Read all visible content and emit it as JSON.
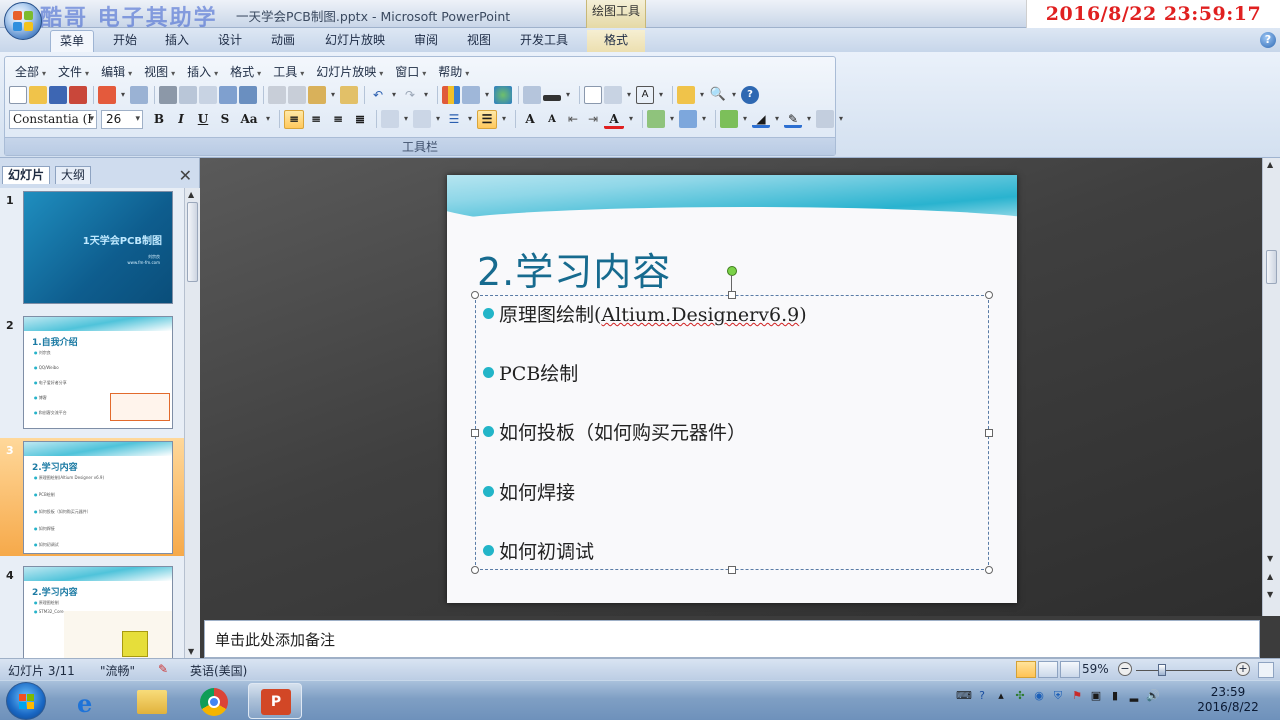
{
  "window": {
    "doc_title": "一天学会PCB制图.pptx",
    "app_name": "Microsoft PowerPoint",
    "context_tool": "绘图工具",
    "watermark": "酷哥 电子其助学",
    "datetime_overlay": "2016/8/22 23:59:17"
  },
  "ribbon_tabs": [
    {
      "label": "菜单",
      "active": true
    },
    {
      "label": "开始"
    },
    {
      "label": "插入"
    },
    {
      "label": "设计"
    },
    {
      "label": "动画"
    },
    {
      "label": "幻灯片放映"
    },
    {
      "label": "审阅"
    },
    {
      "label": "视图"
    },
    {
      "label": "开发工具"
    },
    {
      "label": "格式",
      "context": true
    }
  ],
  "menu_bar": [
    "全部",
    "文件",
    "编辑",
    "视图",
    "插入",
    "格式",
    "工具",
    "幻灯片放映",
    "窗口",
    "帮助"
  ],
  "font": {
    "name": "Constantia (I",
    "size": "26"
  },
  "format_buttons": {
    "bold": "B",
    "italic": "I",
    "underline": "U",
    "shadow": "S",
    "case": "Aa"
  },
  "toolbar_group_label": "工具栏",
  "left_pane": {
    "tabs": [
      "幻灯片",
      "大纲"
    ],
    "close": "✕",
    "slides": [
      {
        "num": "1",
        "title": "1天学会PCB制图",
        "sub1": "刘宗良",
        "sub2": "www.fm-fm.com"
      },
      {
        "num": "2",
        "title": "1.自我介绍",
        "lines": [
          "刘宗良",
          "QQ/Weibo",
          "电子爱好者分享",
          "博客",
          "和创客交流平台"
        ]
      },
      {
        "num": "3",
        "title": "2.学习内容",
        "lines": [
          "原理图绘制(Altium Designer v6.9)",
          "PCB绘制",
          "如何投板（如何购买元器件）",
          "如何焊接",
          "如何初调试"
        ]
      },
      {
        "num": "4",
        "title": "2.学习内容",
        "lines": [
          "原理图绘制",
          "STM32_Core"
        ]
      }
    ],
    "selected": "3"
  },
  "slide": {
    "title": "2.学习内容",
    "bullets": [
      {
        "pre": "原理图绘制(",
        "squiggle": "Altium.Designerv6.9",
        "post": ")"
      },
      {
        "pre": "PCB绘制",
        "squiggle": "",
        "post": ""
      },
      {
        "pre": "如何投板（如何购买元器件）",
        "squiggle": "",
        "post": ""
      },
      {
        "pre": "如何焊接",
        "squiggle": "",
        "post": ""
      },
      {
        "pre": "如何初调试",
        "squiggle": "",
        "post": ""
      }
    ]
  },
  "notes_placeholder": "单击此处添加备注",
  "status": {
    "slide_pos": "幻灯片 3/11",
    "theme": "\"流畅\"",
    "language": "英语(美国)",
    "zoom": "59%",
    "zoom_value": 0.59
  },
  "taskbar": {
    "time": "23:59",
    "date": "2016/8/22"
  },
  "colors": {
    "accent": "#23b5c8",
    "title": "#176b8f",
    "overlay_text": "#e02020"
  }
}
